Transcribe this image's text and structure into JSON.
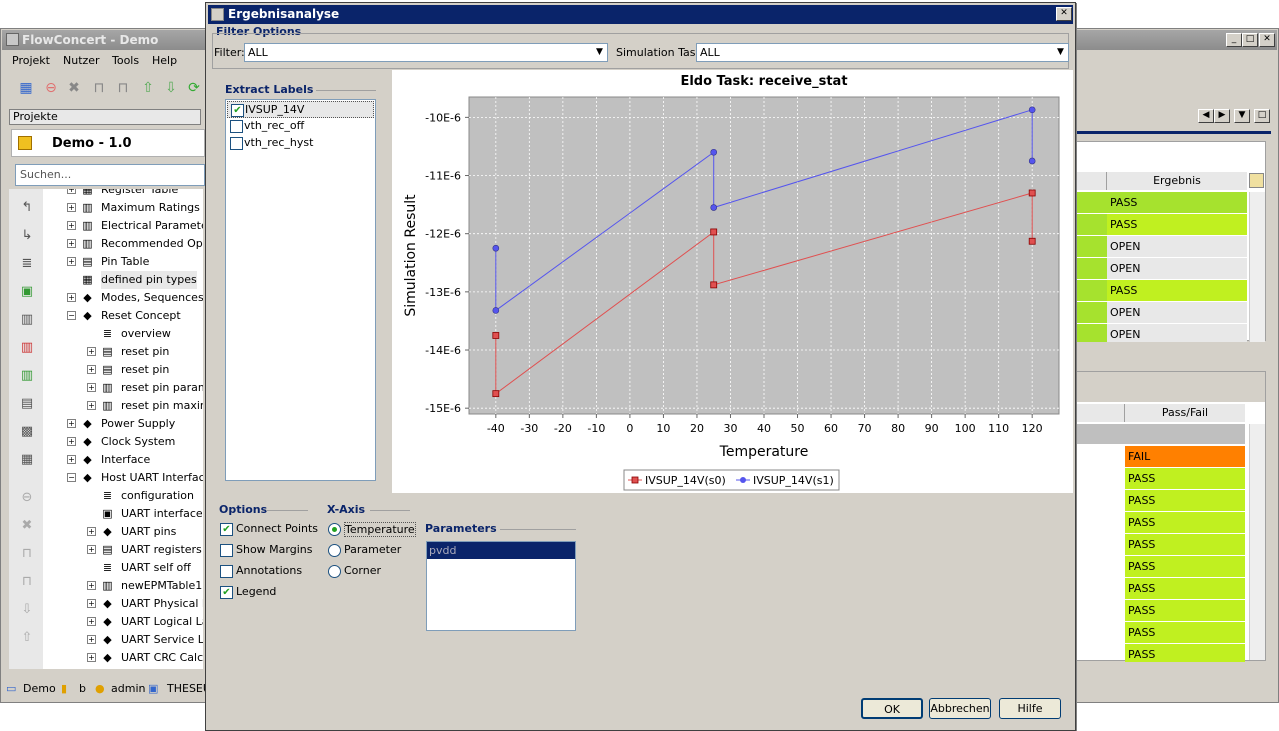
{
  "main_window": {
    "title": "FlowConcert - Demo",
    "menu": [
      "Projekt",
      "Nutzer",
      "Tools",
      "Help"
    ],
    "projects_label": "Projekte",
    "project_name": "Demo - 1.0",
    "search_placeholder": "Suchen...",
    "tree": [
      {
        "label": "Register Table",
        "indent": 1
      },
      {
        "label": "Maximum Ratings",
        "indent": 1
      },
      {
        "label": "Electrical Parameters",
        "indent": 1
      },
      {
        "label": "Recommended Operating",
        "indent": 1
      },
      {
        "label": "Pin Table",
        "indent": 1
      },
      {
        "label": "defined pin types",
        "indent": 1
      },
      {
        "label": "Modes, Sequences",
        "indent": 1
      },
      {
        "label": "Reset Concept",
        "indent": 1
      },
      {
        "label": "overview",
        "indent": 2
      },
      {
        "label": "reset pin",
        "indent": 2
      },
      {
        "label": "reset pin",
        "indent": 2
      },
      {
        "label": "reset pin parameters",
        "indent": 2
      },
      {
        "label": "reset pin maximum",
        "indent": 2
      },
      {
        "label": "Power Supply",
        "indent": 1
      },
      {
        "label": "Clock System",
        "indent": 1
      },
      {
        "label": "Interface",
        "indent": 1
      },
      {
        "label": "Host UART Interface",
        "indent": 1
      },
      {
        "label": "configuration",
        "indent": 2
      },
      {
        "label": "UART interface",
        "indent": 2
      },
      {
        "label": "UART pins",
        "indent": 2
      },
      {
        "label": "UART registers",
        "indent": 2
      },
      {
        "label": "UART self off",
        "indent": 2
      },
      {
        "label": "newEPMTable1",
        "indent": 2
      },
      {
        "label": "UART Physical Layer",
        "indent": 2
      },
      {
        "label": "UART Logical Layer",
        "indent": 2
      },
      {
        "label": "UART Service Layer",
        "indent": 2
      },
      {
        "label": "UART CRC Calculation",
        "indent": 2
      }
    ],
    "status_bar": {
      "project": "Demo",
      "item": "b",
      "user": "admin",
      "host": "THESEUS"
    },
    "right_table_top": {
      "header": "Ergebnis",
      "rows": [
        {
          "value": "PASS",
          "color": "#a6e22e"
        },
        {
          "value": "PASS",
          "color": "#c0f020"
        },
        {
          "value": "OPEN",
          "color": "#e8e8e8"
        },
        {
          "value": "OPEN",
          "color": "#e8e8e8"
        },
        {
          "value": "PASS",
          "color": "#c0f020"
        },
        {
          "value": "OPEN",
          "color": "#e8e8e8"
        },
        {
          "value": "OPEN",
          "color": "#e8e8e8"
        }
      ]
    },
    "right_table_bottom": {
      "header": "Pass/Fail",
      "rows": [
        {
          "value": "FAIL",
          "color": "#ff8000"
        },
        {
          "value": "PASS",
          "color": "#c0f020"
        },
        {
          "value": "PASS",
          "color": "#c0f020"
        },
        {
          "value": "PASS",
          "color": "#c0f020"
        },
        {
          "value": "PASS",
          "color": "#c0f020"
        },
        {
          "value": "PASS",
          "color": "#c0f020"
        },
        {
          "value": "PASS",
          "color": "#c0f020"
        },
        {
          "value": "PASS",
          "color": "#c0f020"
        },
        {
          "value": "PASS",
          "color": "#c0f020"
        },
        {
          "value": "PASS",
          "color": "#c0f020"
        }
      ]
    }
  },
  "dialog": {
    "title": "Ergebnisanalyse",
    "filter_options_label": "Filter Options",
    "filter_label": "Filter:",
    "filter_value": "ALL",
    "sim_task_label": "Simulation Task:",
    "sim_task_value": "ALL",
    "extract_labels_title": "Extract Labels",
    "extract_labels": [
      {
        "label": "IVSUP_14V",
        "checked": true
      },
      {
        "label": "vth_rec_off",
        "checked": false
      },
      {
        "label": "vth_rec_hyst",
        "checked": false
      }
    ],
    "options_title": "Options",
    "options": [
      {
        "label": "Connect Points",
        "checked": true
      },
      {
        "label": "Show Margins",
        "checked": false
      },
      {
        "label": "Annotations",
        "checked": false
      },
      {
        "label": "Legend",
        "checked": true
      }
    ],
    "xaxis_title": "X-Axis",
    "xaxis_options": [
      {
        "label": "Temperature",
        "selected": true
      },
      {
        "label": "Parameter",
        "selected": false
      },
      {
        "label": "Corner",
        "selected": false
      }
    ],
    "parameters_title": "Parameters",
    "parameters": [
      "pvdd"
    ],
    "buttons": {
      "ok": "OK",
      "cancel": "Abbrechen",
      "help": "Hilfe"
    }
  },
  "chart_data": {
    "type": "line",
    "title": "Eldo Task: receive_stat",
    "xlabel": "Temperature",
    "ylabel": "Simulation Result",
    "xlim": [
      -48,
      128
    ],
    "ylim": [
      -15.1,
      -9.65
    ],
    "x_ticks": [
      -40,
      -30,
      -20,
      -10,
      0,
      10,
      20,
      30,
      40,
      50,
      60,
      70,
      80,
      90,
      100,
      110,
      120
    ],
    "y_ticks": [
      -10,
      -11,
      -12,
      -13,
      -14,
      -15
    ],
    "y_tick_labels": [
      "-10E-6",
      "-11E-6",
      "-12E-6",
      "-13E-6",
      "-14E-6",
      "-15E-6"
    ],
    "grid": true,
    "legend_position": "bottom",
    "series": [
      {
        "name": "IVSUP_14V(s0)",
        "color": "#e05050",
        "marker": "square",
        "x": [
          -40,
          -40,
          25,
          25,
          120,
          120
        ],
        "y": [
          -13.75,
          -14.75,
          -11.97,
          -12.88,
          -11.3,
          -12.13
        ]
      },
      {
        "name": "IVSUP_14V(s1)",
        "color": "#5555ee",
        "marker": "circle",
        "x": [
          -40,
          -40,
          25,
          25,
          120,
          120
        ],
        "y": [
          -12.25,
          -13.32,
          -10.6,
          -11.55,
          -9.87,
          -10.75
        ]
      }
    ]
  }
}
